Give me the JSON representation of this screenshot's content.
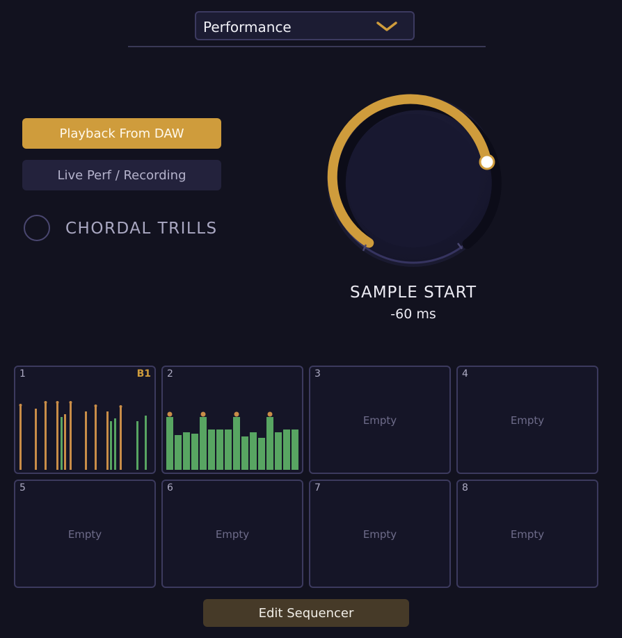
{
  "header": {
    "preset_dropdown": {
      "selected": "Performance",
      "icon": "chevron-down-icon"
    }
  },
  "playback": {
    "daw_label": "Playback From DAW",
    "live_label": "Live Perf / Recording",
    "active": "daw"
  },
  "chordal_trills": {
    "label": "CHORDAL TRILLS",
    "checked": false
  },
  "sample_start": {
    "label": "SAMPLE START",
    "value_text": "-60 ms",
    "level": 0.87
  },
  "pads": [
    {
      "number": "1",
      "tag": "B1",
      "empty_label": "",
      "filled": true
    },
    {
      "number": "2",
      "tag": "",
      "empty_label": "",
      "filled": true
    },
    {
      "number": "3",
      "tag": "",
      "empty_label": "Empty",
      "filled": false
    },
    {
      "number": "4",
      "tag": "",
      "empty_label": "Empty",
      "filled": false
    },
    {
      "number": "5",
      "tag": "",
      "empty_label": "Empty",
      "filled": false
    },
    {
      "number": "6",
      "tag": "",
      "empty_label": "Empty",
      "filled": false
    },
    {
      "number": "7",
      "tag": "",
      "empty_label": "Empty",
      "filled": false
    },
    {
      "number": "8",
      "tag": "",
      "empty_label": "Empty",
      "filled": false
    }
  ],
  "edit_sequencer_label": "Edit Sequencer",
  "colors": {
    "accent": "#cf9c3c",
    "background": "#12121f",
    "pad_green": "#58a562",
    "pad_orange": "#c98d48"
  }
}
